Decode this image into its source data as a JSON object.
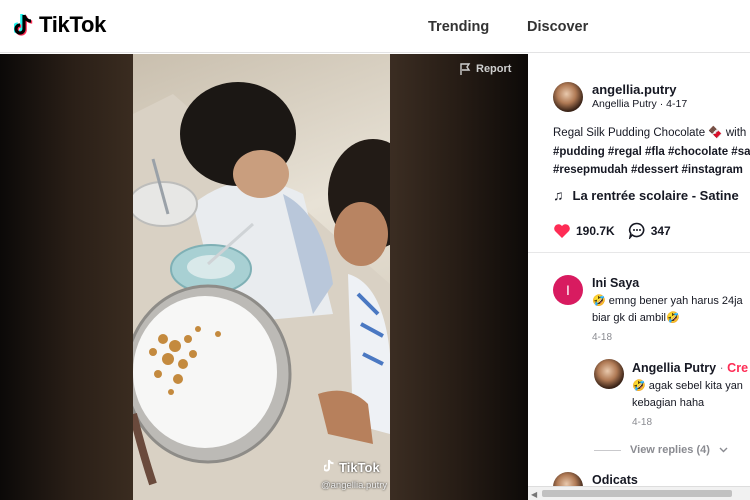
{
  "header": {
    "logo_text": "TikTok",
    "nav": [
      "Trending",
      "Discover"
    ]
  },
  "video": {
    "report_label": "Report",
    "watermark_brand": "TikTok",
    "watermark_handle": "@angellia.putry"
  },
  "post": {
    "username": "angellia.putry",
    "display_name": "Angellia Putry",
    "date": "4-17",
    "description_line1": "Regal Silk Pudding Chocolate 🍫 with",
    "description_tags1": "#pudding #regal #fla #chocolate #sa",
    "description_tags2": "#resepmudah #dessert #instagram",
    "music": "La rentrée scolaire - Satine",
    "likes": "190.7K",
    "comments": "347"
  },
  "comments": [
    {
      "avatar_letter": "I",
      "name": "Ini Saya",
      "text_line1": "🤣 emng bener yah harus 24ja",
      "text_line2": "biar gk di ambil🤣",
      "date": "4-18",
      "reply": {
        "name": "Angellia Putry",
        "badge": "Cre",
        "text_line1": "🤣 agak sebel kita yan",
        "text_line2": "kebagian haha",
        "date": "4-18"
      },
      "view_replies": "View replies (4)"
    },
    {
      "name": "Odicats"
    }
  ],
  "colors": {
    "accent": "#fe2c55",
    "comment_avatar": "#d81b60"
  }
}
